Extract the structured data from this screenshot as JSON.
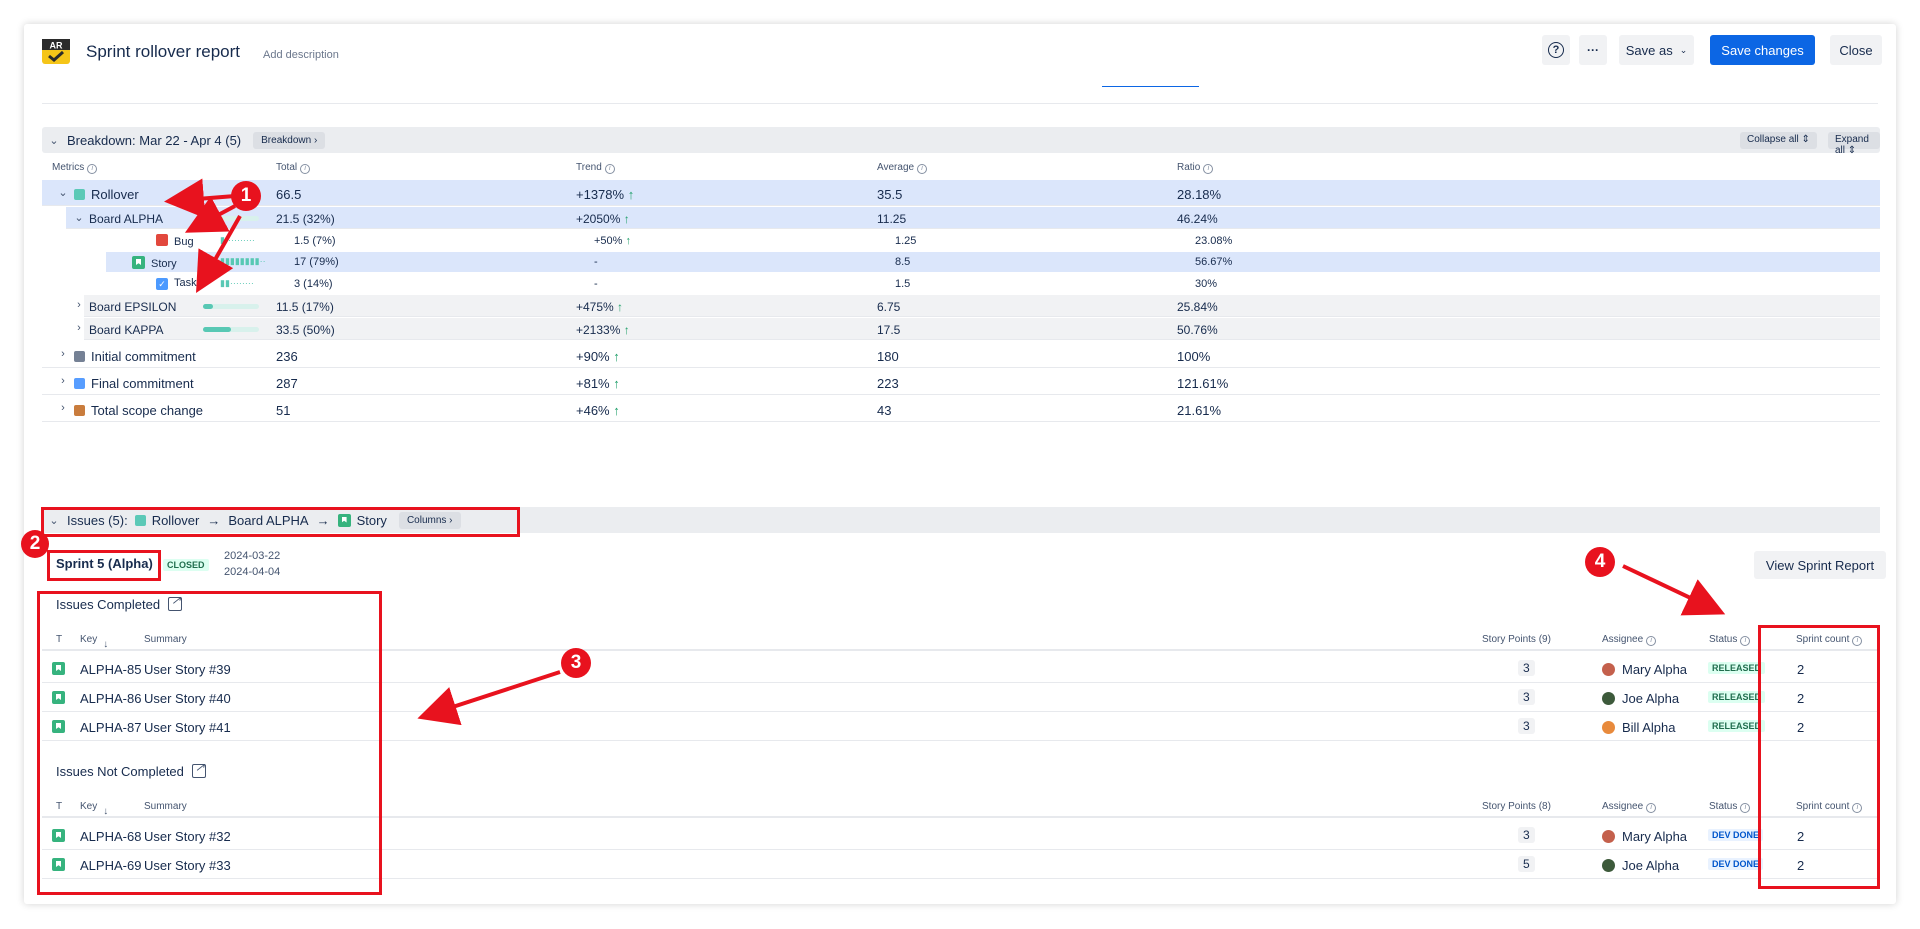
{
  "header": {
    "title": "Sprint rollover report",
    "add_description": "Add description",
    "logo_text": "AR",
    "help_label": "?",
    "more_label": "···",
    "save_as_label": "Save as",
    "save_changes_label": "Save changes",
    "close_label": "Close"
  },
  "breakdown": {
    "title": "Breakdown: Mar 22 - Apr 4 (5)",
    "pill": "Breakdown",
    "collapse_all": "Collapse all",
    "expand_all": "Expand all",
    "columns": {
      "metrics": "Metrics",
      "total": "Total",
      "trend": "Trend",
      "average": "Average",
      "ratio": "Ratio"
    },
    "rows": [
      {
        "label": "Rollover",
        "total": "66.5",
        "trend": "+1378%",
        "average": "35.5",
        "ratio": "28.18%",
        "color": "#5bc9b7"
      },
      {
        "label": "Board ALPHA",
        "total": "21.5 (32%)",
        "trend": "+2050%",
        "average": "11.25",
        "ratio": "46.24%",
        "progress": 0.32
      },
      {
        "label": "Bug",
        "total": "1.5 (7%)",
        "trend": "+50%",
        "average": "1.25",
        "ratio": "23.08%"
      },
      {
        "label": "Story",
        "total": "17 (79%)",
        "trend": "-",
        "average": "8.5",
        "ratio": "56.67%"
      },
      {
        "label": "Task",
        "total": "3 (14%)",
        "trend": "-",
        "average": "1.5",
        "ratio": "30%"
      },
      {
        "label": "Board EPSILON",
        "total": "11.5 (17%)",
        "trend": "+475%",
        "average": "6.75",
        "ratio": "25.84%",
        "progress": 0.17
      },
      {
        "label": "Board KAPPA",
        "total": "33.5 (50%)",
        "trend": "+2133%",
        "average": "17.5",
        "ratio": "50.76%",
        "progress": 0.5
      },
      {
        "label": "Initial commitment",
        "total": "236",
        "trend": "+90%",
        "average": "180",
        "ratio": "100%",
        "color": "#758195"
      },
      {
        "label": "Final commitment",
        "total": "287",
        "trend": "+81%",
        "average": "223",
        "ratio": "121.61%",
        "color": "#579dff"
      },
      {
        "label": "Total scope change",
        "total": "51",
        "trend": "+46%",
        "average": "43",
        "ratio": "21.61%",
        "color": "#c97c3d"
      }
    ]
  },
  "issues": {
    "prefix": "Issues (5):",
    "crumb1": "Rollover",
    "crumb2": "Board ALPHA",
    "crumb3": "Story",
    "columns_pill": "Columns",
    "sprint_name": "Sprint 5 (Alpha)",
    "sprint_status": "CLOSED",
    "start_date": "2024-03-22",
    "end_date": "2024-04-04",
    "view_sprint_report": "View Sprint Report",
    "cols": {
      "t": "T",
      "key": "Key",
      "summary": "Summary",
      "assignee": "Assignee",
      "status": "Status",
      "sprint_count": "Sprint count"
    },
    "completed": {
      "title": "Issues Completed",
      "story_points_header": "Story Points (9)",
      "rows": [
        {
          "key": "ALPHA-85",
          "summary": "User Story #39",
          "points": "3",
          "assignee": "Mary Alpha",
          "status": "RELEASED",
          "sprint_count": "2"
        },
        {
          "key": "ALPHA-86",
          "summary": "User Story #40",
          "points": "3",
          "assignee": "Joe Alpha",
          "status": "RELEASED",
          "sprint_count": "2"
        },
        {
          "key": "ALPHA-87",
          "summary": "User Story #41",
          "points": "3",
          "assignee": "Bill Alpha",
          "status": "RELEASED",
          "sprint_count": "2"
        }
      ]
    },
    "not_completed": {
      "title": "Issues Not Completed",
      "story_points_header": "Story Points (8)",
      "rows": [
        {
          "key": "ALPHA-68",
          "summary": "User Story #32",
          "points": "3",
          "assignee": "Mary Alpha",
          "status": "DEV DONE",
          "sprint_count": "2"
        },
        {
          "key": "ALPHA-69",
          "summary": "User Story #33",
          "points": "5",
          "assignee": "Joe Alpha",
          "status": "DEV DONE",
          "sprint_count": "2"
        }
      ]
    }
  },
  "annotations": {
    "m1": "1",
    "m2": "2",
    "m3": "3",
    "m4": "4"
  }
}
